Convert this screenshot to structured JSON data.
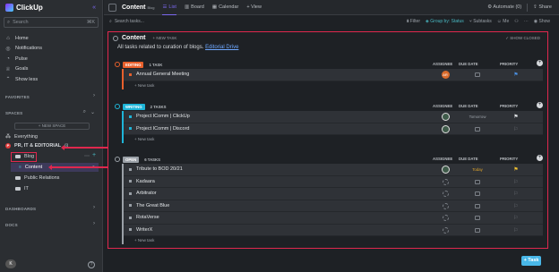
{
  "sidebar": {
    "logo_text": "ClickUp",
    "search_placeholder": "Search",
    "search_kbd": "⌘K",
    "nav": [
      {
        "icon": "home-icon",
        "glyph": "⌂",
        "label": "Home"
      },
      {
        "icon": "bell-icon",
        "glyph": "◎",
        "label": "Notifications"
      },
      {
        "icon": "pulse-icon",
        "glyph": "◔",
        "label": "Pulse"
      },
      {
        "icon": "trophy-icon",
        "glyph": "♕",
        "label": "Goals"
      },
      {
        "icon": "show-less-icon",
        "glyph": "⌃",
        "label": "Show less"
      }
    ],
    "favorites_label": "FAVORITES",
    "spaces_label": "SPACES",
    "new_space_label": "+ NEW SPACE",
    "everything_label": "Everything",
    "space_name": "PR, IT & EDITORIAL",
    "space_initial": "P",
    "folder_blog": "Blog",
    "list_content": "Content",
    "list_content_count": "7",
    "folder_pr": "Public Relations",
    "folder_it": "IT",
    "dashboards_label": "DASHBOARDS",
    "docs_label": "DOCS",
    "user_initial": "K",
    "accent": "#7b68ee",
    "annotation_color": "#e0284e"
  },
  "topbar": {
    "title": "Content",
    "subtitle": "Blog",
    "tabs": [
      {
        "label": "List",
        "icon": "list-icon",
        "glyph": "☰",
        "active": true
      },
      {
        "label": "Board",
        "icon": "board-icon",
        "glyph": "▥",
        "active": false
      },
      {
        "label": "Calendar",
        "icon": "calendar-icon",
        "glyph": "▦",
        "active": false
      },
      {
        "label": "+ View",
        "icon": "",
        "glyph": "",
        "active": false
      }
    ],
    "automate_label": "Automate",
    "automate_count": "(0)",
    "share_label": "Share"
  },
  "toolbar": {
    "search_placeholder": "Search tasks...",
    "filter_label": "Filter",
    "group_label": "Group by: Status",
    "subtasks_label": "Subtasks",
    "me_label": "Me",
    "show_label": "Show"
  },
  "panel": {
    "title": "Content",
    "new_task_label": "+ NEW TASK",
    "show_closed_label": "SHOW CLOSED",
    "description": "All tasks related to curation of blogs.",
    "description_link": "Editorial Drive",
    "col_assignee": "ASSIGNEE",
    "col_due": "DUE DATE",
    "col_priority": "PRIORITY",
    "new_task_row_label": "+ New task",
    "groups": [
      {
        "status": "EDITING",
        "count": "1 TASK",
        "color": "#e8602c",
        "tasks": [
          {
            "name": "Annual General Meeting",
            "assignee": "AR",
            "assignee_type": "initials",
            "due": "",
            "priority_color": "#4a90e2"
          }
        ]
      },
      {
        "status": "WRITING",
        "count": "2 TASKS",
        "color": "#1eb5d8",
        "tasks": [
          {
            "name": "Project IComm | ClickUp",
            "assignee": "",
            "assignee_type": "photo",
            "due": "Tomorrow",
            "priority_color": "#e2e5e8"
          },
          {
            "name": "Project IComm | Discord",
            "assignee": "",
            "assignee_type": "photo",
            "due": "",
            "priority_color": ""
          }
        ]
      },
      {
        "status": "OPEN",
        "count": "6 TASKS",
        "color": "#9aa0a7",
        "tasks": [
          {
            "name": "Tribute to BOD 20/21",
            "assignee": "",
            "assignee_type": "photo",
            "due": "Today",
            "priority_color": "#f2c230"
          },
          {
            "name": "Kadaara",
            "assignee": "",
            "assignee_type": "empty",
            "due": "",
            "priority_color": ""
          },
          {
            "name": "Arbitrator",
            "assignee": "",
            "assignee_type": "empty",
            "due": "",
            "priority_color": ""
          },
          {
            "name": "The Great Blue",
            "assignee": "",
            "assignee_type": "empty",
            "due": "",
            "priority_color": ""
          },
          {
            "name": "RotaVerse",
            "assignee": "",
            "assignee_type": "empty",
            "due": "",
            "priority_color": ""
          },
          {
            "name": "WriterX",
            "assignee": "",
            "assignee_type": "empty",
            "due": "",
            "priority_color": ""
          }
        ]
      }
    ]
  },
  "add_task_label": "+ Task"
}
